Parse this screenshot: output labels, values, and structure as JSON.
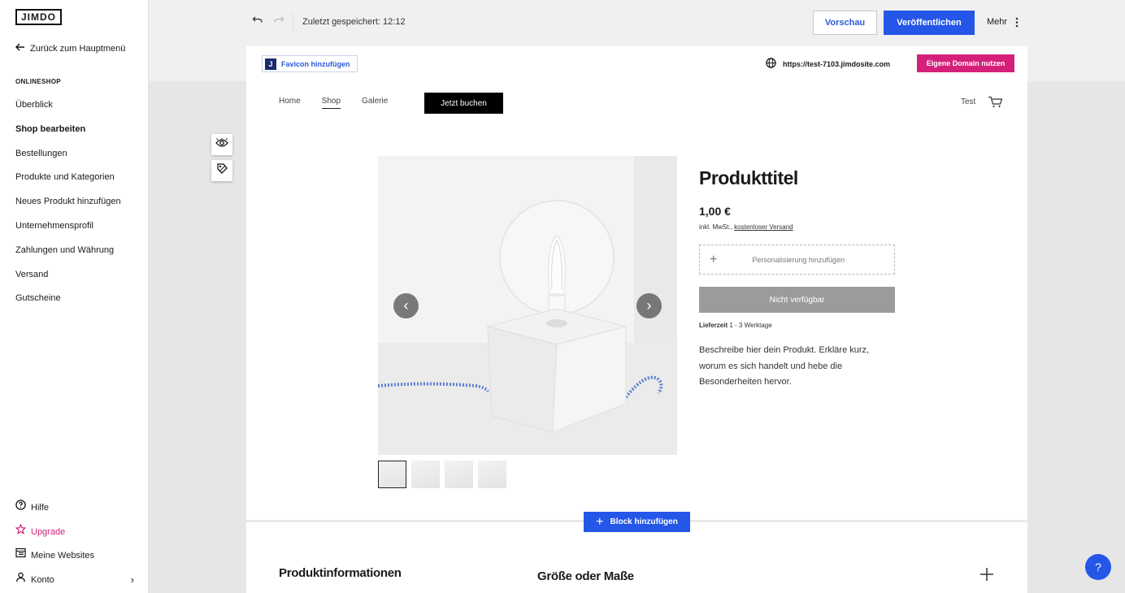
{
  "sidebar": {
    "logo": "JIMDO",
    "back_label": "Zurück zum Hauptmenü",
    "section_title": "ONLINESHOP",
    "items": [
      {
        "label": "Überblick"
      },
      {
        "label": "Shop bearbeiten"
      },
      {
        "label": "Bestellungen"
      },
      {
        "label": "Produkte und Kategorien"
      },
      {
        "label": "Neues Produkt hinzufügen"
      },
      {
        "label": "Unternehmensprofil"
      },
      {
        "label": "Zahlungen und Währung"
      },
      {
        "label": "Versand"
      },
      {
        "label": "Gutscheine"
      }
    ],
    "active_item": "Shop bearbeiten",
    "bottom": {
      "help": "Hilfe",
      "upgrade": "Upgrade",
      "websites": "Meine Websites",
      "account": "Konto"
    }
  },
  "topbar": {
    "saved_status": "Zuletzt gespeichert: 12:12",
    "preview_label": "Vorschau",
    "publish_label": "Veröffentlichen",
    "more_label": "Mehr"
  },
  "site_header": {
    "favicon_label": "Favicon hinzufügen",
    "favicon_letter": "J",
    "domain_url": "https://test-7103.jimdosite.com",
    "domain_button": "Eigene Domain nutzen"
  },
  "site_nav": {
    "items": [
      {
        "label": "Home"
      },
      {
        "label": "Shop"
      },
      {
        "label": "Galerie"
      }
    ],
    "active": "Shop",
    "cta": "Jetzt buchen",
    "user": "Test"
  },
  "product": {
    "title": "Produkttitel",
    "price": "1,00 €",
    "tax_text": "inkl. MwSt.,",
    "shipping_link": "kostenloser Versand",
    "personalize": "Personalisierung hinzufügen",
    "availability": "Nicht verfügbar",
    "delivery_label": "Lieferzeit",
    "delivery_value": "1 - 3 Werktage",
    "description": "Beschreibe hier dein Produkt. Erkläre kurz, worum es sich handelt und hebe die Besonderheiten hervor.",
    "thumbnail_count": 4
  },
  "add_block_label": "Block hinzufügen",
  "info_section": {
    "title": "Produktinformationen",
    "accordion_title": "Größe oder Maße"
  },
  "help_bubble": "?",
  "colors": {
    "accent_blue": "#2456e8",
    "brand_pink": "#d4207a"
  }
}
